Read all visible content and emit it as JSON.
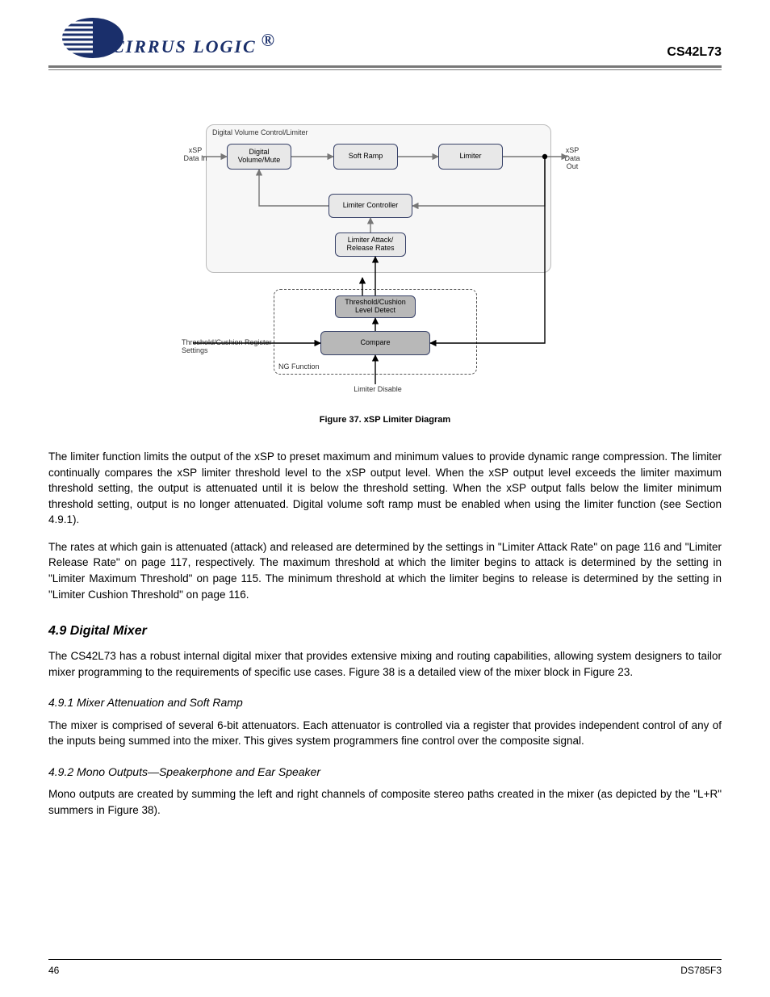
{
  "header": {
    "brand": "CIRRUS LOGIC",
    "part": "CS42L73"
  },
  "diagram": {
    "frame_label": "Digital Volume Control/Limiter",
    "in_label": "xSP\nData In",
    "out_label": "xSP\nData Out",
    "box_vol": "Digital\nVolume/Mute",
    "box_soft": "Soft Ramp",
    "box_limiter": "Limiter",
    "box_controller": "Limiter Controller",
    "box_rates": "Limiter Attack/\nRelease Rates",
    "box_threshold": "Threshold/Cushion\nLevel Detect",
    "box_cmp": "Compare",
    "ng_label": "NG Function",
    "thr_label": "Threshold/Cushion Register Settings",
    "lim_disable": "Limiter Disable"
  },
  "caption": "Figure 37. xSP Limiter Diagram",
  "para1": "The limiter function limits the output of the xSP to preset maximum and minimum values to provide dynamic range compression. The limiter continually compares the xSP limiter threshold level to the xSP output level. When the xSP output level exceeds the limiter maximum threshold setting, the output is attenuated until it is below the threshold setting. When the xSP output falls below the limiter minimum threshold setting, output is no longer attenuated. Digital volume soft ramp must be enabled when using the limiter function (see Section 4.9.1).",
  "para2": "The rates at which gain is attenuated (attack) and released are determined by the settings in \"Limiter Attack Rate\" on page 116 and \"Limiter Release Rate\" on page 117, respectively. The maximum threshold at which the limiter begins to attack is determined by the setting in \"Limiter Maximum Threshold\" on page 115. The minimum threshold at which the limiter begins to release is determined by the setting in \"Limiter Cushion Threshold\" on page 116.",
  "h_mixer": "4.9  Digital Mixer",
  "mixer_p": "The CS42L73 has a robust internal digital mixer that provides extensive mixing and routing capabilities, allowing system designers to tailor mixer programming to the requirements of specific use cases. Figure 38 is a detailed view of the mixer block in Figure 23.",
  "h_attn": "4.9.1   Mixer Attenuation and Soft Ramp",
  "attn_p": "The mixer is comprised of several 6-bit attenuators. Each attenuator is controlled via a register that provides independent control of any of the inputs being summed into the mixer. This gives system programmers fine control over the composite signal.",
  "h_mono": "4.9.2   Mono Outputs—Speakerphone and Ear Speaker",
  "mono_p": "Mono outputs are created by summing the left and right channels of composite stereo paths created in the mixer (as depicted by the \"L+R\" summers in Figure 38).",
  "footer": {
    "left": "46",
    "right": "DS785F3"
  }
}
